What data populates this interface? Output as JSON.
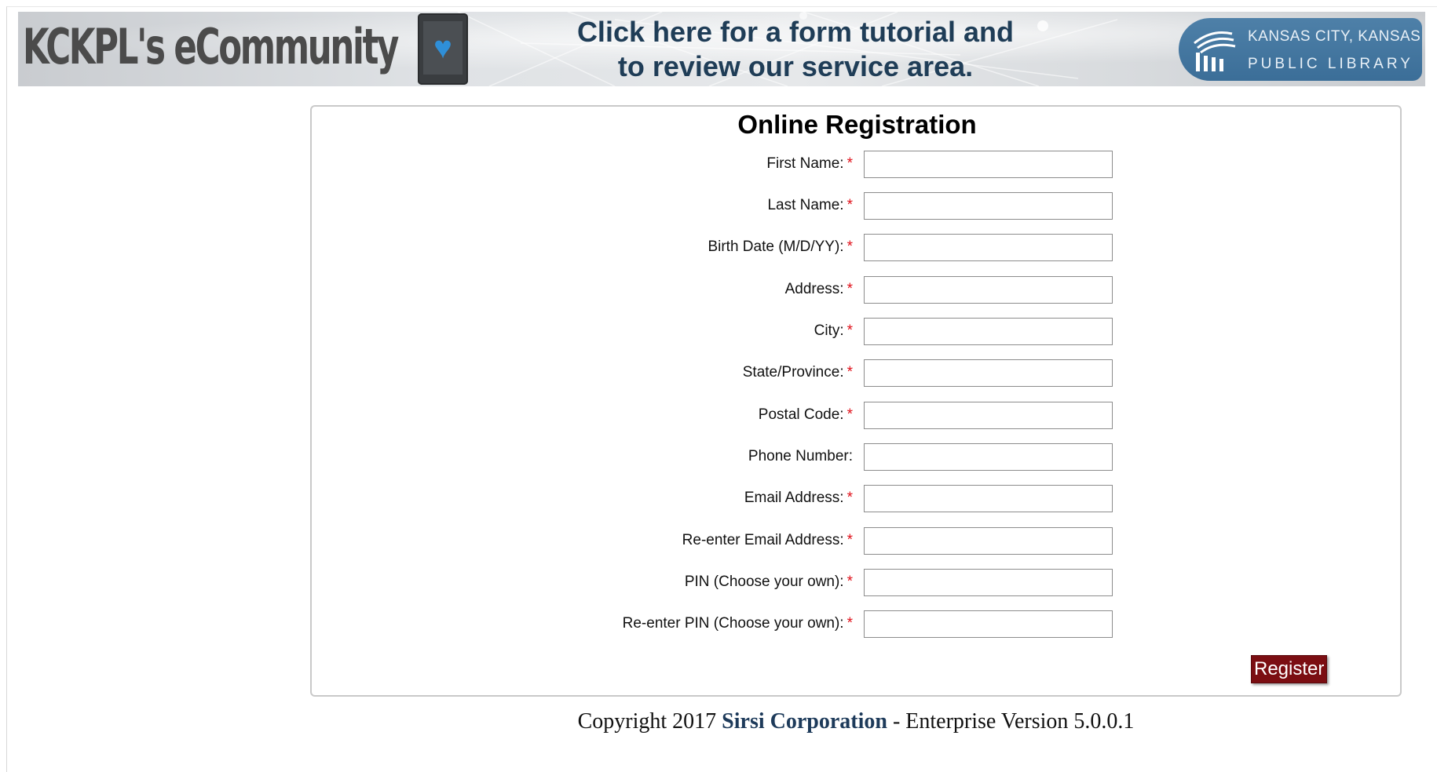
{
  "banner": {
    "ecommunity_title": "KCKPL's eCommunity",
    "tablet_icon": "heart-tablet-icon",
    "tutorial_link_line1": "Click here for a form tutorial and",
    "tutorial_link_line2": "to review our service area.",
    "library_logo": {
      "line1": "KANSAS CITY, KANSAS",
      "line2": "PUBLIC LIBRARY",
      "icon": "library-columns-icon"
    }
  },
  "form": {
    "title": "Online Registration",
    "required_marker": "*",
    "fields": [
      {
        "label": "First Name:",
        "required": true,
        "value": ""
      },
      {
        "label": "Last Name:",
        "required": true,
        "value": ""
      },
      {
        "label": "Birth Date (M/D/YY):",
        "required": true,
        "value": ""
      },
      {
        "label": "Address:",
        "required": true,
        "value": ""
      },
      {
        "label": "City:",
        "required": true,
        "value": ""
      },
      {
        "label": "State/Province:",
        "required": true,
        "value": ""
      },
      {
        "label": "Postal Code:",
        "required": true,
        "value": ""
      },
      {
        "label": "Phone Number:",
        "required": false,
        "value": ""
      },
      {
        "label": "Email Address:",
        "required": true,
        "value": ""
      },
      {
        "label": "Re-enter Email Address:",
        "required": true,
        "value": ""
      },
      {
        "label": "PIN (Choose your own):",
        "required": true,
        "value": ""
      },
      {
        "label": "Re-enter PIN (Choose your own):",
        "required": true,
        "value": ""
      }
    ],
    "register_label": "Register"
  },
  "footer": {
    "prefix": "Copyright 2017",
    "company": "Sirsi Corporation",
    "suffix": "- Enterprise Version 5.0.0.1"
  },
  "colors": {
    "register_bg": "#7b0e12",
    "required": "#e0101a",
    "link_text": "#1f3d57",
    "logo_bg": "#3b6e98"
  }
}
